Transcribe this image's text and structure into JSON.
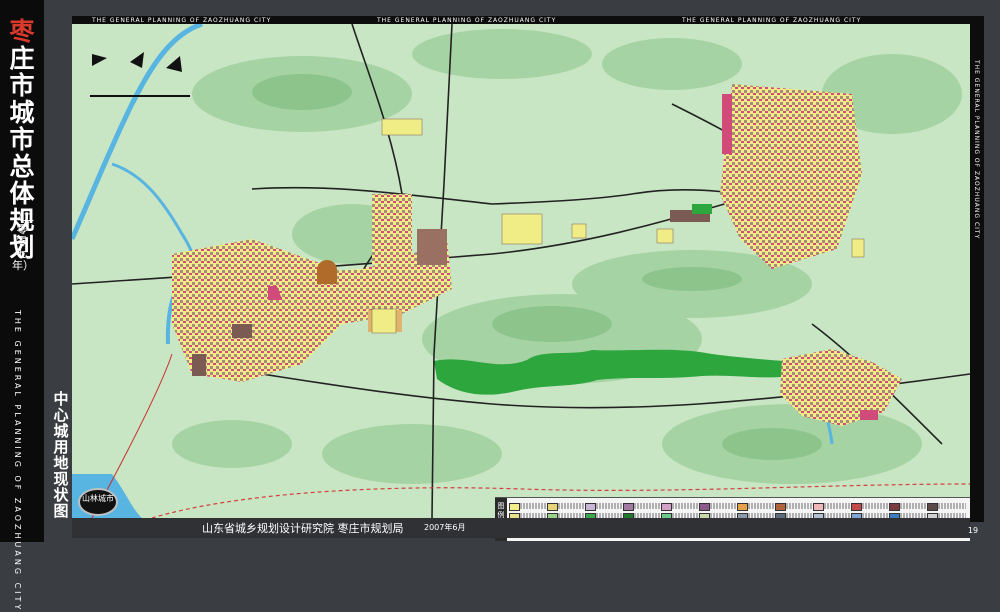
{
  "title": {
    "accent_char": "枣",
    "rest": "庄市城市总体规划"
  },
  "year": "（二零零七年）",
  "vertical_english": "THE GENERAL PLANNING OF ZAOZHUANG CITY",
  "top_banner": "THE GENERAL PLANNING OF ZAOZHUANG CITY",
  "subtitle": "中心城用地现状图",
  "badge": "山林城市",
  "institute": "山东省城乡规划设计研究院  枣庄市规划局",
  "date": "2007年6月",
  "page_number": "19",
  "legend": {
    "header": "图例",
    "swatches": [
      "#f3ef8a",
      "#e7d37a",
      "#c8b6d6",
      "#a07aa0",
      "#d4a2c9",
      "#8c5a8c",
      "#e6a24a",
      "#b0643c",
      "#f0b8b8",
      "#c44a4a",
      "#7a3c3c",
      "#5a4a4a",
      "#e8e08a",
      "#9ad28a",
      "#3aa84a",
      "#1e7a2e",
      "#6acb8a",
      "#c8d8a8",
      "#8a9aa8",
      "#5c6c7c",
      "#b0c0d0",
      "#7fa8d8",
      "#3c7cc0",
      "#d0d0d0",
      "#9c9c9c",
      "#f8c8a0",
      "#c89a6a",
      "#e0e0c0",
      "#aad4e8",
      "#88aa66",
      "#ffffff",
      "#cccccc",
      "#444444",
      "#d6b4e0",
      "#a0c878",
      "#66a2c8"
    ]
  },
  "colors": {
    "terrain": "#c9e6c4",
    "hill": "#9ccc9c",
    "forest": "#2ea63e",
    "water": "#58b4e0",
    "road": "#222222",
    "city_yellow": "#f0ec86",
    "city_brown": "#7a5a52",
    "city_pink": "#d04a7a"
  }
}
